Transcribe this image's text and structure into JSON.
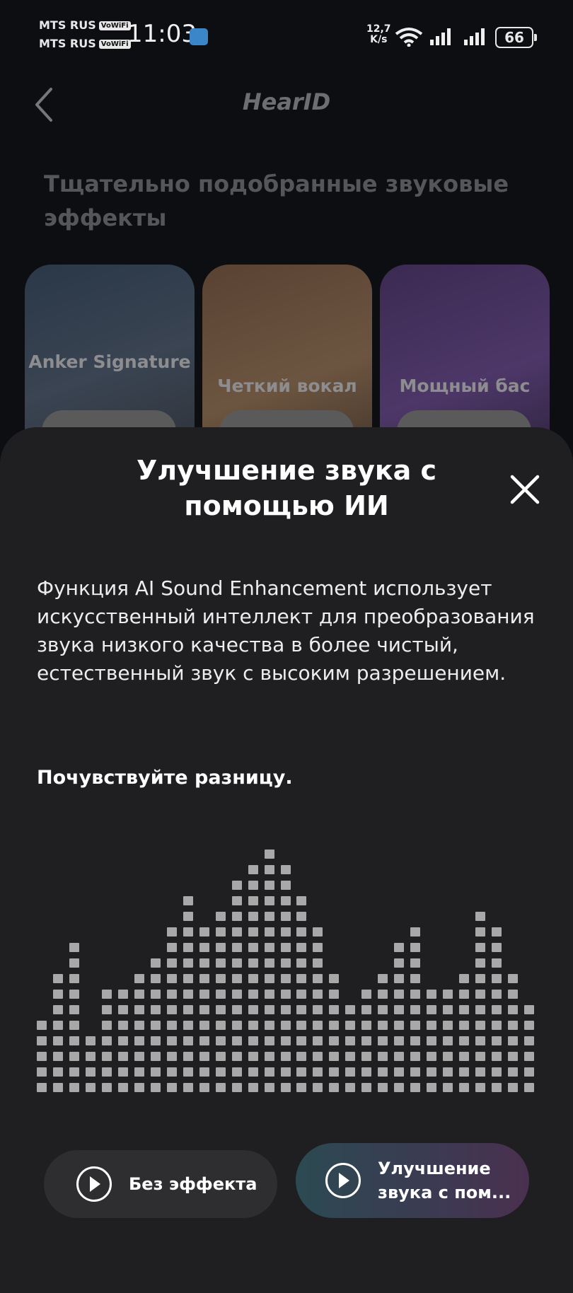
{
  "status_bar": {
    "carrier1": "MTS RUS",
    "carrier2": "MTS RUS",
    "vowifi": "VoWiFi",
    "time": "11:03",
    "speed_value": "12,7",
    "speed_unit": "K/s",
    "battery": "66"
  },
  "header": {
    "title": "HearID"
  },
  "section": {
    "title": "Тщательно подобранные звуковые эффекты"
  },
  "cards": [
    {
      "label": "Anker Signature"
    },
    {
      "label": "Четкий вокал"
    },
    {
      "label": "Мощный бас"
    }
  ],
  "sheet": {
    "title": "Улучшение звука с помощью ИИ",
    "description": "Функция AI Sound Enhancement использует искусственный интеллект для преобразования звука низкого качества в более чистый, естественный звук с высоким разрешением.",
    "subtitle": "Почувствуйте разницу.",
    "equalizer_levels": [
      5,
      8,
      10,
      4,
      7,
      7,
      8,
      9,
      11,
      13,
      11,
      12,
      14,
      15,
      16,
      15,
      13,
      11,
      8,
      6,
      7,
      8,
      10,
      11,
      7,
      7,
      8,
      12,
      11,
      8,
      6
    ]
  },
  "buttons": {
    "no_effect": "Без эффекта",
    "enhanced": "Улучшение звука с пом..."
  },
  "colors": {
    "sheet_bg": "#1f1f21",
    "page_bg": "#0d0e12",
    "eq_block": "#a8a8a8"
  }
}
